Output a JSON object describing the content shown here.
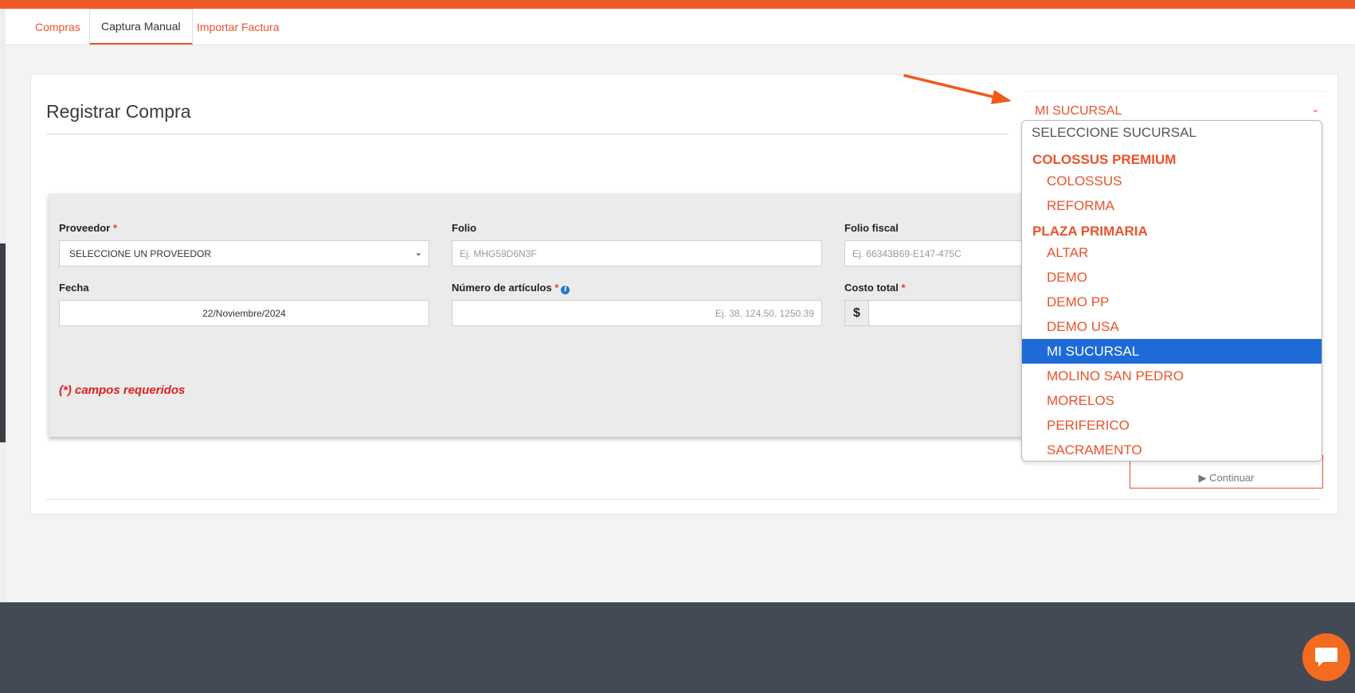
{
  "tabs": [
    {
      "label": "Compras"
    },
    {
      "label": "Captura Manual"
    },
    {
      "label": "Importar Factura"
    }
  ],
  "card": {
    "title": "Registrar Compra",
    "branch_selected": "MI SUCURSAL"
  },
  "form": {
    "proveedor": {
      "label": "Proveedor",
      "value": "SELECCIONE UN PROVEEDOR"
    },
    "folio": {
      "label": "Folio",
      "placeholder": "Ej. MHG59D6N3F"
    },
    "folio_fiscal": {
      "label": "Folio fiscal",
      "placeholder": "Ej. 66343B69-E147-475C"
    },
    "fecha": {
      "label": "Fecha",
      "value": "22/Noviembre/2024"
    },
    "numero_articulos": {
      "label": "Número de artículos",
      "placeholder": "Ej. 38, 124.50, 1250.39"
    },
    "costo_total": {
      "label": "Costo total",
      "currency": "$"
    },
    "required_marker": "*",
    "required_note": "(*) campos requeridos",
    "continue_label": "▶ Continuar"
  },
  "dropdown": {
    "placeholder_option": "SELECCIONE SUCURSAL",
    "groups": [
      {
        "name": "COLOSSUS PREMIUM",
        "options": [
          "COLOSSUS",
          "REFORMA"
        ]
      },
      {
        "name": "PLAZA PRIMARIA",
        "options": [
          "ALTAR",
          "DEMO",
          "DEMO PP",
          "DEMO USA",
          "MI SUCURSAL",
          "MOLINO SAN PEDRO",
          "MORELOS",
          "PERIFERICO",
          "SACRAMENTO"
        ]
      }
    ],
    "selected": "MI SUCURSAL"
  },
  "colors": {
    "accent": "#e9532b",
    "topbar": "#f05a2a",
    "selected_bg": "#1e6bd8",
    "footer": "#434a54"
  }
}
